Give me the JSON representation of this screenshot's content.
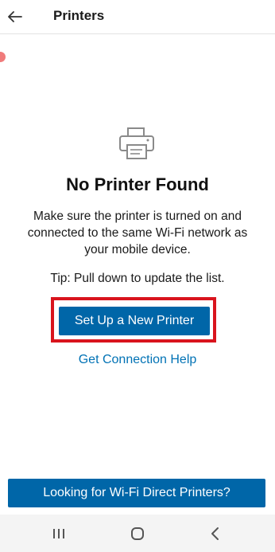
{
  "app_bar": {
    "back_icon": "arrow-left-icon",
    "title": "Printers"
  },
  "empty_state": {
    "icon": "printer-icon",
    "heading": "No Printer Found",
    "message_lines": [
      "Make sure the printer is turned on and",
      "connected to the same Wi-Fi network as",
      "your mobile device."
    ],
    "tip": "Tip: Pull down to update the list.",
    "setup_button": "Set Up a New Printer",
    "help_link": "Get Connection Help"
  },
  "footer": {
    "wifi_direct_button": "Looking for Wi-Fi Direct Printers?"
  },
  "nav_bar": {
    "icons": [
      "recent-apps-icon",
      "home-icon",
      "back-icon"
    ]
  },
  "colors": {
    "primary_button": "#0066a8",
    "link": "#0072b5",
    "highlight": "#d9141d"
  }
}
